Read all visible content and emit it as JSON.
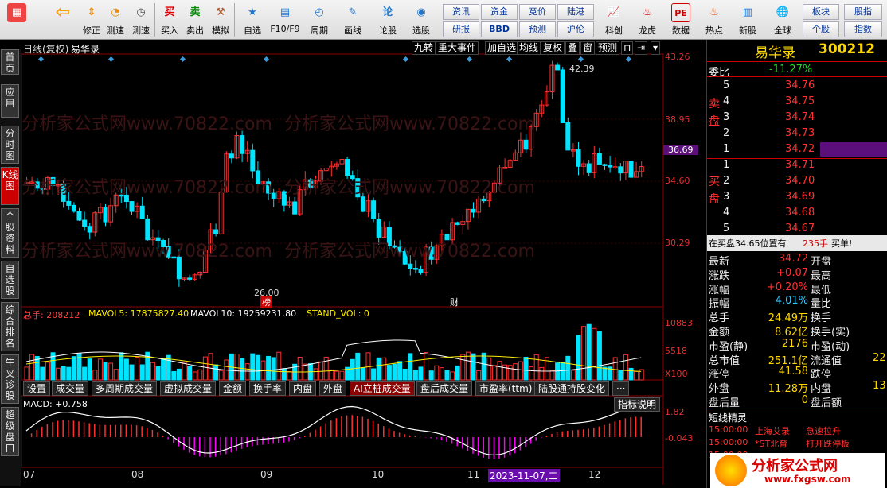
{
  "toolbar": {
    "buttons": [
      {
        "label": "",
        "icon": "grid-icon"
      },
      {
        "label": "",
        "icon": "back-icon"
      },
      {
        "label": "修正",
        "icon": "edit-icon"
      },
      {
        "label": "测速",
        "icon": "timer-icon"
      },
      {
        "label": "买入",
        "icon": "buy-icon"
      },
      {
        "label": "卖出",
        "icon": "sell-icon"
      },
      {
        "label": "模拟",
        "icon": "hammer-icon"
      },
      {
        "label": "自选",
        "icon": "star-icon"
      },
      {
        "label": "F10/F9",
        "icon": "f10-icon"
      },
      {
        "label": "周期",
        "icon": "period-icon"
      },
      {
        "label": "画线",
        "icon": "pen-icon"
      },
      {
        "label": "论股",
        "icon": "discuss-icon"
      },
      {
        "label": "选股",
        "icon": "select-icon"
      }
    ],
    "small_buttons": [
      "资讯",
      "资金",
      "竞价",
      "陆港",
      "研报",
      "BBD",
      "预测",
      "沪伦"
    ],
    "right_buttons": [
      {
        "label": "科创",
        "icon": "chart-icon"
      },
      {
        "label": "龙虎",
        "icon": "dragon-icon"
      },
      {
        "label": "数据",
        "icon": "pe-icon"
      },
      {
        "label": "热点",
        "icon": "hot-icon"
      },
      {
        "label": "新股",
        "icon": "new-icon"
      },
      {
        "label": "全球",
        "icon": "globe-icon"
      }
    ],
    "far_right": [
      "板块",
      "股指",
      "个股",
      "指数"
    ]
  },
  "left_tabs": [
    "首页",
    "应用",
    "分时图",
    "K线图",
    "个股资料",
    "自选股",
    "综合排名",
    "牛叉诊股",
    "超级盘口"
  ],
  "chart": {
    "title": "日线(复权)",
    "stock_name": "易华录",
    "menu": [
      "九转",
      "重大事件",
      "加自选",
      "均线",
      "复权",
      "叠",
      "窗",
      "预测"
    ],
    "watermark": "分析家公式网www.70822.com",
    "price_axis": [
      "43.26",
      "38.95",
      "36.69",
      "34.60",
      "30.29"
    ],
    "high_label": "42.39",
    "low_label": "26.00",
    "markers": [
      "榜",
      "财"
    ],
    "volume_header": {
      "total": "总手: 208212",
      "mavol5": "MAVOL5: 17875827.40",
      "mavol10": "MAVOL10: 19259231.80",
      "stand": "STAND_VOL: 0"
    },
    "volume_axis": [
      "10883",
      "5518",
      "X100"
    ],
    "tabs": [
      "设置",
      "成交量",
      "多周期成交量",
      "虚拟成交量",
      "金额",
      "换手率",
      "内盘",
      "外盘",
      "AI立桩成交量",
      "盘后成交量",
      "市盈率(ttm)",
      "陆股通持股变化",
      "···"
    ],
    "macd_label": "MACD: +0.758",
    "indicator_btn": "指标说明",
    "macd_axis": [
      "1.82",
      "-0.043"
    ],
    "dates": [
      "07",
      "08",
      "09",
      "10",
      "11",
      "2023-11-07,二",
      "12"
    ]
  },
  "right_panel": {
    "name": "易华录",
    "code": "300212",
    "weibi_label": "委比",
    "weibi_value": "-11.27%",
    "sell_label": "卖盘",
    "buy_label": "买盘",
    "sells": [
      {
        "n": "5",
        "p": "34.76"
      },
      {
        "n": "4",
        "p": "34.75"
      },
      {
        "n": "3",
        "p": "34.74"
      },
      {
        "n": "2",
        "p": "34.73"
      },
      {
        "n": "1",
        "p": "34.72"
      }
    ],
    "buys": [
      {
        "n": "1",
        "p": "34.71"
      },
      {
        "n": "2",
        "p": "34.70"
      },
      {
        "n": "3",
        "p": "34.69"
      },
      {
        "n": "4",
        "p": "34.68"
      },
      {
        "n": "5",
        "p": "34.67"
      }
    ],
    "r_mark": "R",
    "order_info": "在买盘34.65位置有",
    "order_qty": "235手",
    "order_type": "买单!",
    "stats": [
      {
        "l1": "最新",
        "v1": "34.72",
        "l2": "开盘"
      },
      {
        "l1": "涨跌",
        "v1": "+0.07",
        "l2": "最高"
      },
      {
        "l1": "涨幅",
        "v1": "+0.20%",
        "l2": "最低"
      },
      {
        "l1": "振幅",
        "v1": "4.01%",
        "l2": "量比"
      },
      {
        "l1": "总手",
        "v1": "24.49万",
        "l2": "换手"
      },
      {
        "l1": "金额",
        "v1": "8.62亿",
        "l2": "换手(实)"
      },
      {
        "l1": "市盈(静)",
        "v1": "2176",
        "l2": "市盈(动)"
      },
      {
        "l1": "总市值",
        "v1": "251.1亿",
        "l2": "流通值",
        "v2": "22"
      },
      {
        "l1": "涨停",
        "v1": "41.58",
        "l2": "跌停"
      },
      {
        "l1": "外盘",
        "v1": "11.28万",
        "l2": "内盘",
        "v2": "13"
      },
      {
        "l1": "盘后量",
        "v1": "0",
        "l2": "盘后额"
      }
    ],
    "sprite_title": "短线精灵",
    "sprites": [
      {
        "t": "15:00:00",
        "a": "上海艾录",
        "b": "急速拉升"
      },
      {
        "t": "15:00:00",
        "a": "*ST北育",
        "b": "打开跌停板"
      },
      {
        "t": "15:00:00",
        "a": "",
        "b": ""
      }
    ],
    "logo_text": "分析家公式网",
    "logo_url": "www.fxgsw.com"
  },
  "colors": {
    "up": "#ff3030",
    "down": "#00e5ff",
    "bg": "#000000"
  }
}
